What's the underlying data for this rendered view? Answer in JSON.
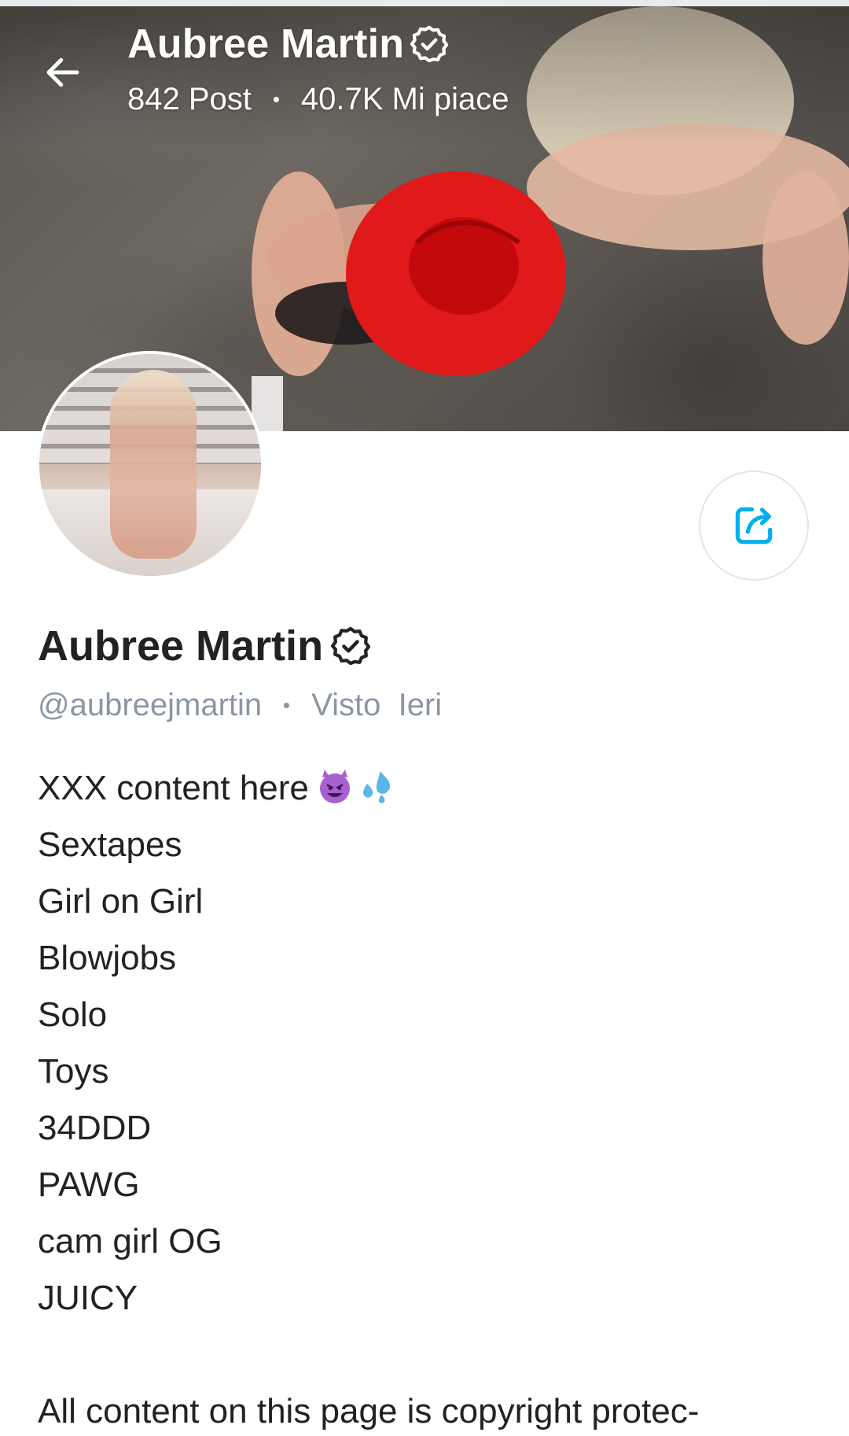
{
  "header": {
    "title": "Aubree Martin",
    "posts": "842 Post",
    "likes": "40.7K Mi piace"
  },
  "profile": {
    "name": "Aubree Martin",
    "handle": "@aubreejmartin",
    "last_seen": "Visto  Ieri"
  },
  "bio": {
    "lines": [
      "XXX content here",
      "Sextapes",
      "Girl on Girl",
      "Blowjobs",
      "Solo",
      "Toys",
      "34DDD",
      "PAWG",
      "cam girl OG",
      "JUICY"
    ],
    "emojis": [
      "smiling-devil-emoji",
      "sweat-droplets-emoji"
    ],
    "footer": "All content on this page is copyright protec-"
  },
  "icons": {
    "back": "arrow-left-icon",
    "verified": "verified-badge-icon",
    "share": "share-icon"
  },
  "colors": {
    "accent": "#00aff0",
    "text": "#222222",
    "muted": "#8a96a3",
    "border": "#e3e5e8"
  }
}
